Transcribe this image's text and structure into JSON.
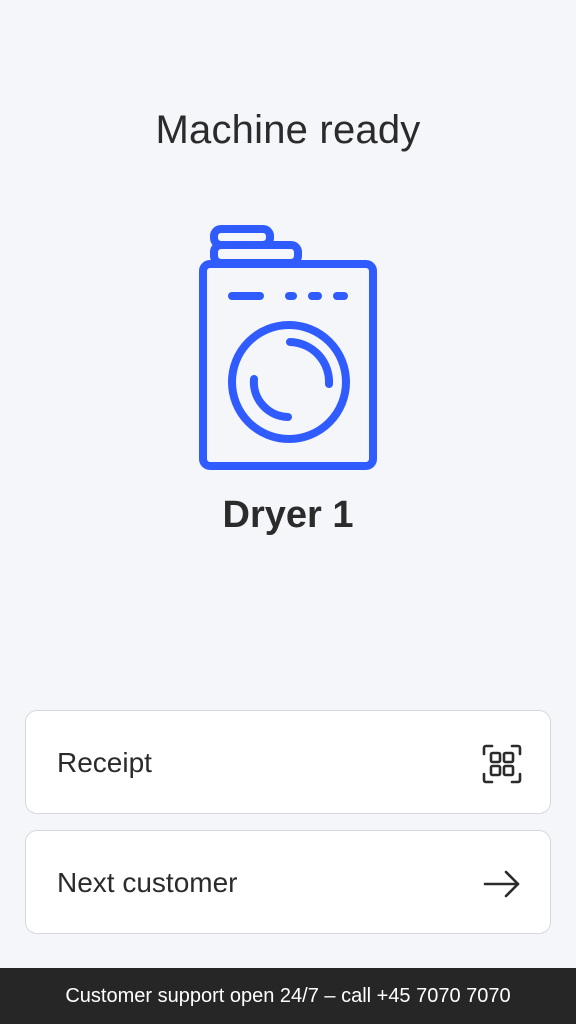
{
  "header": {
    "title": "Machine ready"
  },
  "machine": {
    "icon": "washing-machine-icon",
    "name": "Dryer 1",
    "accent_color": "#2f5bff"
  },
  "actions": [
    {
      "label": "Receipt",
      "icon": "qr-code-icon"
    },
    {
      "label": "Next customer",
      "icon": "arrow-right-icon"
    }
  ],
  "footer": {
    "text": "Customer support open 24/7 – call +45 7070 7070"
  }
}
